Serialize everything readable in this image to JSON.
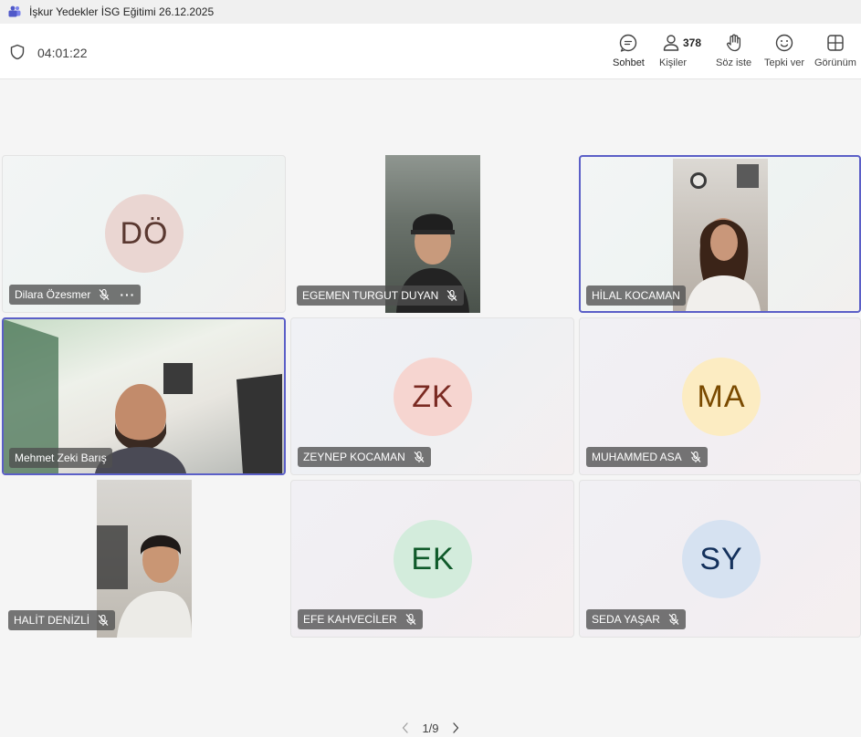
{
  "window": {
    "title": "İşkur Yedekler İSG Eğitimi 26.12.2025"
  },
  "toolbar": {
    "timer": "04:01:22",
    "chat_label": "Sohbet",
    "people_label": "Kişiler",
    "people_count": "378",
    "raise_label": "Söz iste",
    "react_label": "Tepki ver",
    "view_label": "Görünüm"
  },
  "participants": [
    {
      "name": "Dilara Özesmer",
      "initials": "DÖ",
      "avatar_bg": "#ead6d2",
      "avatar_fg": "#5a3830"
    },
    {
      "name": "EGEMEN TURGUT DUYAN"
    },
    {
      "name": "HİLAL KOCAMAN"
    },
    {
      "name": "Mehmet Zeki Barış"
    },
    {
      "name": "ZEYNEP KOCAMAN",
      "initials": "ZK",
      "avatar_bg": "#f6d5d0",
      "avatar_fg": "#7a2a22"
    },
    {
      "name": "MUHAMMED ASA",
      "initials": "MA",
      "avatar_bg": "#fcecc2",
      "avatar_fg": "#7a4a00"
    },
    {
      "name": "HALİT DENİZLİ"
    },
    {
      "name": "EFE KAHVECİLER",
      "initials": "EK",
      "avatar_bg": "#d3ecdc",
      "avatar_fg": "#0f5a2a"
    },
    {
      "name": "SEDA YAŞAR",
      "initials": "SY",
      "avatar_bg": "#d6e2f1",
      "avatar_fg": "#14315c"
    }
  ],
  "pager": {
    "label": "1/9"
  },
  "colors": {
    "accent": "#5b5fc7"
  }
}
